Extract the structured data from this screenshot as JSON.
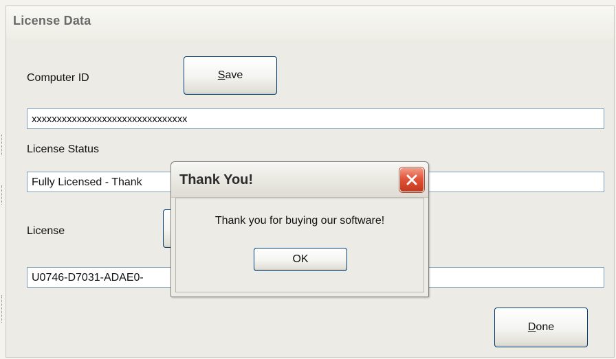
{
  "window": {
    "title": "License Data"
  },
  "form": {
    "computer_id_label": "Computer ID",
    "save_button": {
      "prefix": "",
      "underlined": "S",
      "suffix": "ave"
    },
    "computer_id_value": "xxxxxxxxxxxxxxxxxxxxxxxxxxxxxxx",
    "license_status_label": "License Status",
    "license_status_value": "Fully Licensed - Thank",
    "license_label": "License",
    "license_value": "U0746-D7031-ADAE0-",
    "done_button": {
      "prefix": "",
      "underlined": "D",
      "suffix": "one"
    }
  },
  "dialog": {
    "title": "Thank You!",
    "message": "Thank you for buying our software!",
    "ok_label": "OK",
    "close_icon": "close-x-icon"
  },
  "colors": {
    "close_button": "#e0553b",
    "field_border": "#7f9db9",
    "button_border": "#003c74"
  }
}
